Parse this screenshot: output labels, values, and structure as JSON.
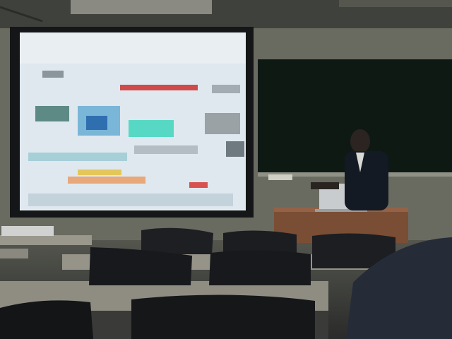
{
  "scene": {
    "description_label": "",
    "colors": {
      "wall": "#6a6b62",
      "ceiling": "#4c4e49",
      "projection_frame": "#1c1e1f",
      "blackboard": "#0f1a16",
      "podium": "#7a4e35",
      "desk_top": "#8e8a80",
      "chair_mesh": "#1a1c1f"
    },
    "objects": [
      {
        "name": "projection-screen",
        "icon": "pixelated-slide"
      },
      {
        "name": "blackboard"
      },
      {
        "name": "presenter"
      },
      {
        "name": "laptop"
      },
      {
        "name": "podium"
      },
      {
        "name": "classroom-desks"
      },
      {
        "name": "mesh-chairs"
      }
    ]
  }
}
